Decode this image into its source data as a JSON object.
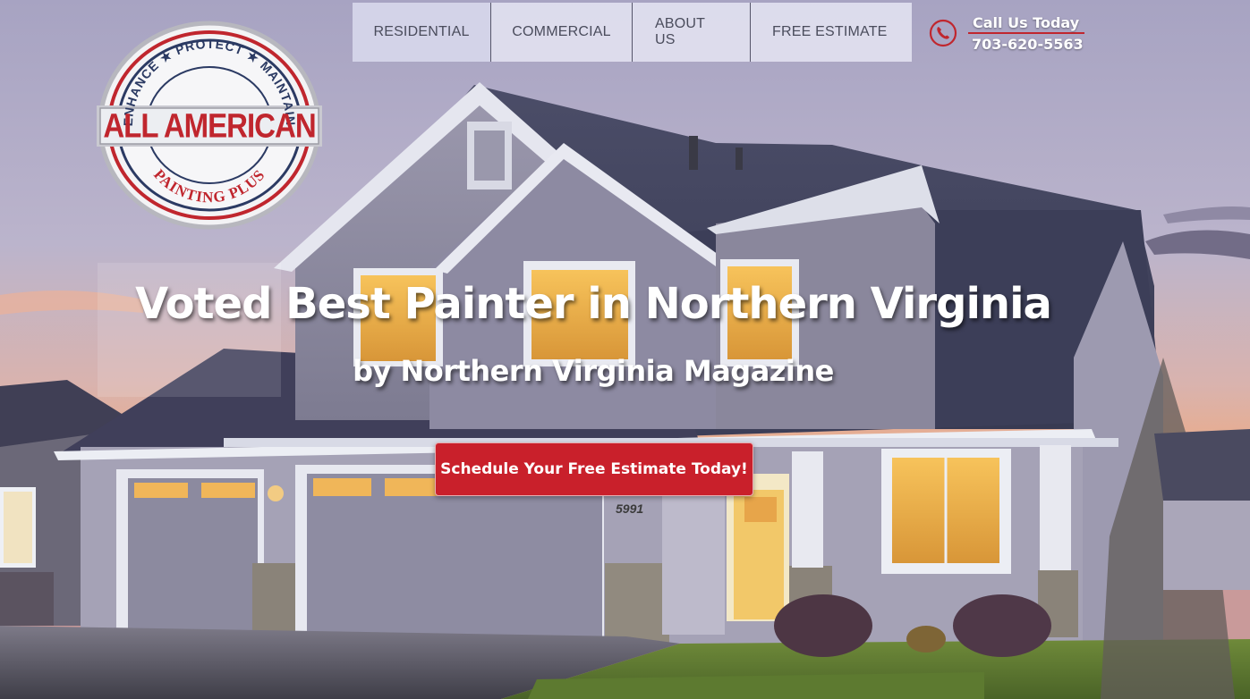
{
  "nav": {
    "items": [
      {
        "label": "RESIDENTIAL"
      },
      {
        "label": "COMMERCIAL"
      },
      {
        "label": "ABOUT US"
      },
      {
        "label": "FREE ESTIMATE"
      }
    ]
  },
  "call": {
    "label": "Call Us Today",
    "number": "703-620-5563",
    "icon": "phone-icon"
  },
  "logo": {
    "top_text": "ENHANCE ★ PROTECT ★ MAINTAIN",
    "main_text": "ALL AMERICAN",
    "bottom_text": "PAINTING PLUS"
  },
  "hero": {
    "headline": "Voted Best Painter in Northern Virginia",
    "subheadline": "by Northern Virginia Magazine",
    "cta_label": "Schedule Your Free Estimate Today!",
    "house_number": "5991"
  },
  "colors": {
    "brand_red": "#c9202b",
    "brand_navy": "#2b3a63",
    "nav_bg": "#e8e8f5"
  }
}
